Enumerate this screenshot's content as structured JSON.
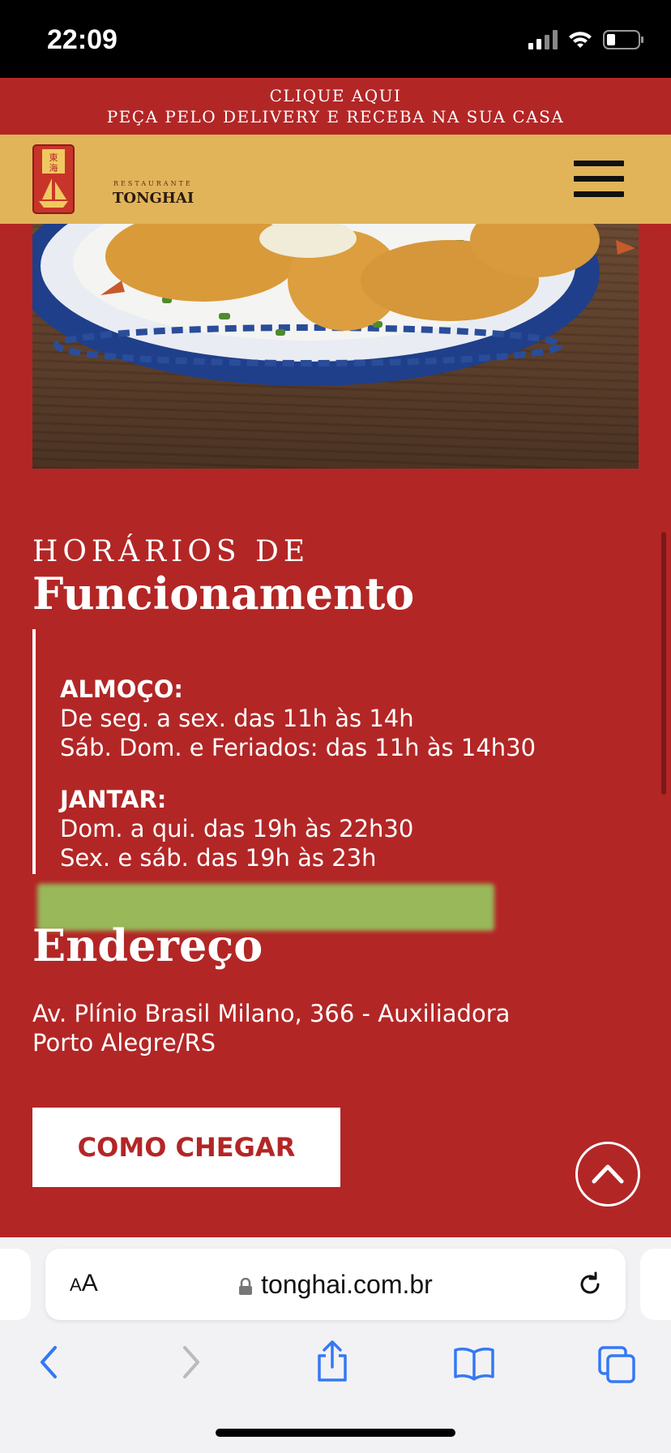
{
  "status_bar": {
    "time": "22:09"
  },
  "promo": {
    "line1": "CLIQUE AQUI",
    "line2": "PEÇA PELO DELIVERY E RECEBA NA SUA CASA"
  },
  "header": {
    "logo_sub": "RESTAURANTE",
    "logo_name": "TONGHAI"
  },
  "hours": {
    "eyebrow": "HORÁRIOS DE",
    "title": "Funcionamento",
    "lunch": {
      "label": "ALMOÇO:",
      "line1": "De seg. a sex. das 11h às 14h",
      "line2": "Sáb. Dom. e Feriados: das 11h às 14h30"
    },
    "dinner": {
      "label": "JANTAR:",
      "line1": "Dom. a qui. das 19h às 22h30",
      "line2": "Sex. e sáb. das 19h às 23h"
    }
  },
  "address": {
    "title": "Endereço",
    "line1": "Av. Plínio Brasil Milano, 366 - Auxiliadora",
    "line2": "Porto Alegre/RS",
    "cta_label": "COMO CHEGAR"
  },
  "browser": {
    "aa_small": "A",
    "aa_large": "A",
    "url": "tonghai.com.br"
  },
  "colors": {
    "primary_red": "#b32626",
    "header_gold": "#e1b45a",
    "safari_blue": "#3478f6"
  }
}
